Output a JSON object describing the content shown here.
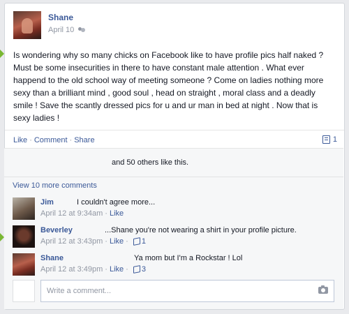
{
  "post": {
    "author": "Shane",
    "date": "April 10",
    "audience_icon": "friends-icon",
    "status": "Is wondering why so many chicks on Facebook like to have profile pics half naked ? Must be some insecurities in there to have constant male attention . What ever happend to the old school way of meeting someone ? Come on ladies nothing more sexy than a brilliant mind , good soul , head on straight , moral class and a deadly smile ! Save the scantly dressed pics for u and ur man in bed at night . Now that is sexy ladies !"
  },
  "actions": {
    "like": "Like",
    "comment": "Comment",
    "share": "Share",
    "separator": "·",
    "comment_count": "1"
  },
  "likes": {
    "text": "and 50 others like this."
  },
  "view_more": "View 10 more comments",
  "comments": [
    {
      "name": "Jim",
      "text": "I couldn't agree more...",
      "time": "April 12 at 9:34am",
      "like": "Like",
      "like_count": ""
    },
    {
      "name": "Beverley",
      "text": "...Shane you're not wearing a shirt in your profile picture.",
      "time": "April 12 at 3:43pm",
      "like": "Like",
      "like_count": "1"
    },
    {
      "name": "Shane",
      "text": "Ya mom but I'm a Rockstar ! Lol",
      "time": "April 12 at 3:49pm",
      "like": "Like",
      "like_count": "3"
    }
  ],
  "reply": {
    "placeholder": "Write a comment..."
  },
  "colors": {
    "link": "#3b5998",
    "marker": "#7ab733",
    "muted": "#9197a3"
  }
}
